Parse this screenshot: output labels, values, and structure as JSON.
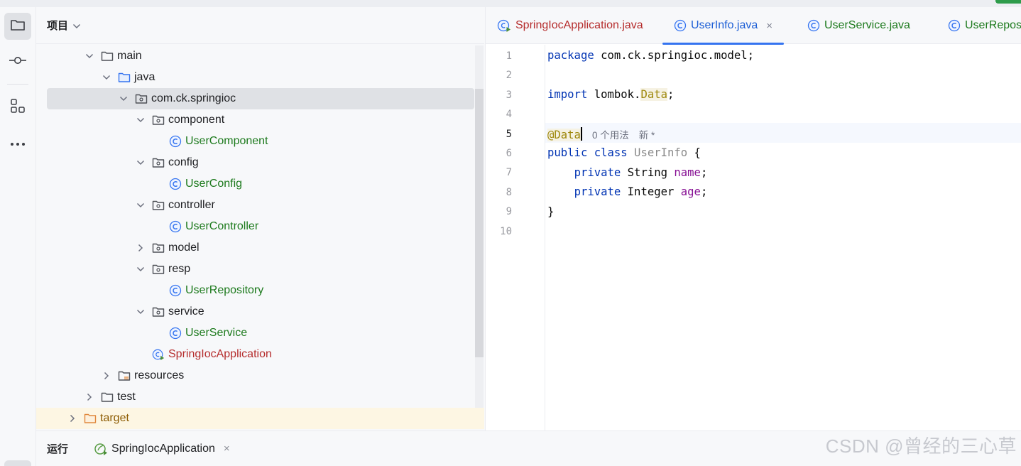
{
  "project_panel": {
    "title": "项目",
    "tree": [
      {
        "label": "main",
        "kind": "folder"
      },
      {
        "label": "java",
        "kind": "source-folder"
      },
      {
        "label": "com.ck.springioc",
        "kind": "package",
        "selected": true
      },
      {
        "label": "component",
        "kind": "package"
      },
      {
        "label": "UserComponent",
        "kind": "class"
      },
      {
        "label": "config",
        "kind": "package"
      },
      {
        "label": "UserConfig",
        "kind": "class"
      },
      {
        "label": "controller",
        "kind": "package"
      },
      {
        "label": "UserController",
        "kind": "class"
      },
      {
        "label": "model",
        "kind": "package",
        "collapsed": true
      },
      {
        "label": "resp",
        "kind": "package"
      },
      {
        "label": "UserRepository",
        "kind": "class"
      },
      {
        "label": "service",
        "kind": "package"
      },
      {
        "label": "UserService",
        "kind": "class"
      },
      {
        "label": "SpringIocApplication",
        "kind": "spring-app"
      },
      {
        "label": "resources",
        "kind": "resources-folder",
        "collapsed": true
      },
      {
        "label": "test",
        "kind": "folder",
        "collapsed": true
      },
      {
        "label": "target",
        "kind": "excluded-folder",
        "collapsed": true,
        "highlight": true
      }
    ]
  },
  "editor": {
    "tabs": [
      {
        "label": "SpringIocApplication.java",
        "kind": "spring-app"
      },
      {
        "label": "UserInfo.java",
        "kind": "class",
        "active": true
      },
      {
        "label": "UserService.java",
        "kind": "class"
      },
      {
        "label": "UserRepos",
        "kind": "class"
      }
    ],
    "close_glyph": "×",
    "line_numbers": [
      "1",
      "2",
      "3",
      "4",
      "5",
      "6",
      "7",
      "8",
      "9",
      "10"
    ],
    "current_line": "5",
    "code": {
      "l1_kw": "package",
      "l1_rest": " com.ck.springioc.model;",
      "l3_kw": "import",
      "l3_pre": " lombok.",
      "l3_ann": "Data",
      "l3_end": ";",
      "l5_ann": "@Data",
      "l5_hint_usages": "0 个用法",
      "l5_hint_new": "新 *",
      "l6_kw": "public class",
      "l6_name": " UserInfo",
      "l6_end": " {",
      "l7_indent": "    ",
      "l7_kw": "private",
      "l7_type": " String ",
      "l7_field": "name",
      "l7_end": ";",
      "l8_indent": "    ",
      "l8_kw": "private",
      "l8_type": " Integer ",
      "l8_field": "age",
      "l8_end": ";",
      "l9": "}"
    }
  },
  "bottom_bar": {
    "run_label": "运行",
    "run_tab": "SpringIocApplication",
    "close_glyph": "×"
  },
  "watermark": "CSDN @曾经的三心草",
  "colors": {
    "keyword": "#0033b3",
    "annotation": "#9e880d",
    "field": "#871094",
    "class_label": "#1d7a1d",
    "app_label": "#b52c2c",
    "active_tab_underline": "#3574f0"
  },
  "icons": [
    "folder-icon",
    "commit-icon",
    "structure-icon",
    "more-icon",
    "chevron-down-icon",
    "chevron-right-icon",
    "package-icon",
    "class-icon",
    "spring-app-icon",
    "resources-folder-icon",
    "close-icon"
  ]
}
